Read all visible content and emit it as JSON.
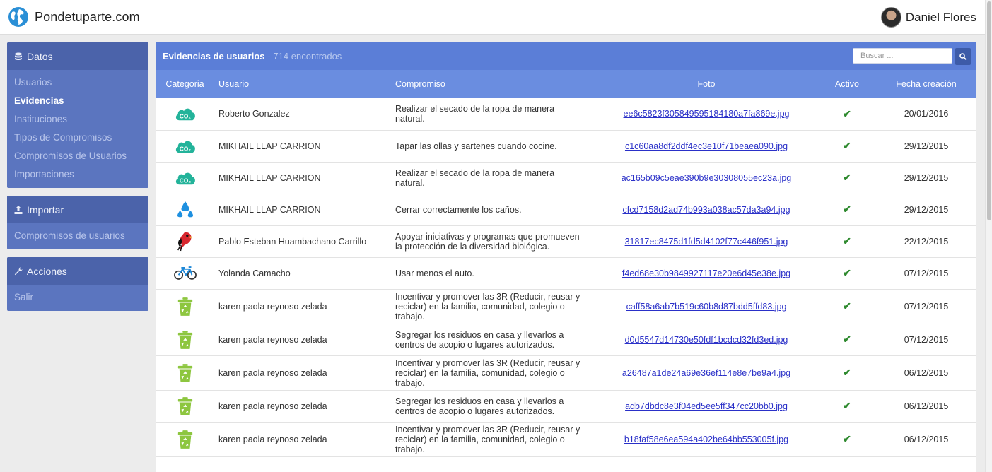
{
  "brand": {
    "name": "Pondetuparte.com"
  },
  "user": {
    "name": "Daniel Flores"
  },
  "sidebar": {
    "sections": [
      {
        "title": "Datos",
        "icon": "database-icon",
        "items": [
          {
            "label": "Usuarios",
            "active": false
          },
          {
            "label": "Evidencias",
            "active": true
          },
          {
            "label": "Instituciones",
            "active": false
          },
          {
            "label": "Tipos de Compromisos",
            "active": false
          },
          {
            "label": "Compromisos de Usuarios",
            "active": false
          },
          {
            "label": "Importaciones",
            "active": false
          }
        ]
      },
      {
        "title": "Importar",
        "icon": "upload-icon",
        "items": [
          {
            "label": "Compromisos de usuarios",
            "active": false
          }
        ]
      },
      {
        "title": "Acciones",
        "icon": "wrench-icon",
        "items": [
          {
            "label": "Salir",
            "active": false
          }
        ]
      }
    ]
  },
  "main": {
    "title": "Evidencias de usuarios",
    "count": "- 714 encontrados",
    "search_placeholder": "Buscar ..."
  },
  "table": {
    "headers": [
      "Categoria",
      "Usuario",
      "Compromiso",
      "Foto",
      "Activo",
      "Fecha creación"
    ],
    "rows": [
      {
        "category": "co2-cloud-icon",
        "user": "Roberto Gonzalez",
        "commitment": "Realizar el secado de la ropa de manera natural.",
        "photo": "ee6c5823f305849595184180a7fa869e.jpg",
        "active": "✔",
        "date": "20/01/2016"
      },
      {
        "category": "co2-cloud-icon",
        "user": "MIKHAIL LLAP CARRION",
        "commitment": "Tapar las ollas y sartenes cuando cocine.",
        "photo": "c1c60aa8df2ddf4ec3e10f71beaea090.jpg",
        "active": "✔",
        "date": "29/12/2015"
      },
      {
        "category": "co2-cloud-icon",
        "user": "MIKHAIL LLAP CARRION",
        "commitment": "Realizar el secado de la ropa de manera natural.",
        "photo": "ac165b09c5eae390b9e30308055ec23a.jpg",
        "active": "✔",
        "date": "29/12/2015"
      },
      {
        "category": "water-drops-icon",
        "user": "MIKHAIL LLAP CARRION",
        "commitment": "Cerrar correctamente los caños.",
        "photo": "cfcd7158d2ad74b993a038ac57da3a94.jpg",
        "active": "✔",
        "date": "29/12/2015"
      },
      {
        "category": "bird-icon",
        "user": "Pablo Esteban Huambachano Carrillo",
        "commitment": "Apoyar iniciativas y programas que promueven la protección de la diversidad biológica.",
        "photo": "31817ec8475d1fd5d4102f77c446f951.jpg",
        "active": "✔",
        "date": "22/12/2015"
      },
      {
        "category": "bicycle-icon",
        "user": "Yolanda Camacho",
        "commitment": "Usar menos el auto.",
        "photo": "f4ed68e30b9849927117e20e6d45e38e.jpg",
        "active": "✔",
        "date": "07/12/2015"
      },
      {
        "category": "recycle-bin-icon",
        "user": "karen paola reynoso zelada",
        "commitment": "Incentivar y promover las 3R (Reducir, reusar y reciclar) en la familia, comunidad, colegio o trabajo.",
        "photo": "caff58a6ab7b519c60b8d87bdd5ffd83.jpg",
        "active": "✔",
        "date": "07/12/2015"
      },
      {
        "category": "recycle-bin-icon",
        "user": "karen paola reynoso zelada",
        "commitment": "Segregar los residuos en casa y llevarlos a centros de acopio o lugares autorizados.",
        "photo": "d0d5547d14730e50fdf1bcdcd32fd3ed.jpg",
        "active": "✔",
        "date": "07/12/2015"
      },
      {
        "category": "recycle-bin-icon",
        "user": "karen paola reynoso zelada",
        "commitment": "Incentivar y promover las 3R (Reducir, reusar y reciclar) en la familia, comunidad, colegio o trabajo.",
        "photo": "a26487a1de24a69e36ef114e8e7be9a4.jpg",
        "active": "✔",
        "date": "06/12/2015"
      },
      {
        "category": "recycle-bin-icon",
        "user": "karen paola reynoso zelada",
        "commitment": "Segregar los residuos en casa y llevarlos a centros de acopio o lugares autorizados.",
        "photo": "adb7dbdc8e3f04ed5ee5ff347cc20bb0.jpg",
        "active": "✔",
        "date": "06/12/2015"
      },
      {
        "category": "recycle-bin-icon",
        "user": "karen paola reynoso zelada",
        "commitment": "Incentivar y promover las 3R (Reducir, reusar y reciclar) en la familia, comunidad, colegio o trabajo.",
        "photo": "b18faf58e6ea594a402be64bb553005f.jpg",
        "active": "✔",
        "date": "06/12/2015"
      }
    ]
  },
  "colors": {
    "header": "#5b7ed7",
    "sidebar": "#5b75bf",
    "link": "#2a30c8",
    "check": "#2f8a2f",
    "co2": "#23b39a",
    "recycle": "#8dc63f"
  }
}
